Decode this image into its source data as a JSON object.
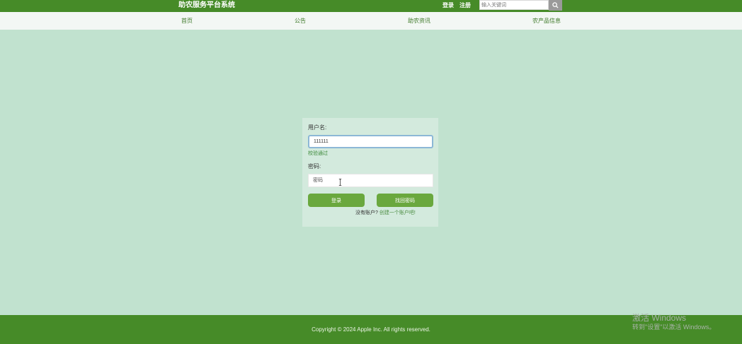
{
  "header": {
    "brand": "助农服务平台系统",
    "login_link": "登录",
    "register_link": "注册",
    "search_placeholder": "输入关键词",
    "search_icon": "search-icon"
  },
  "nav": {
    "items": [
      {
        "label": "首页"
      },
      {
        "label": "公告"
      },
      {
        "label": "助农资讯"
      },
      {
        "label": "农产品信息"
      }
    ]
  },
  "login_form": {
    "username_label": "用户名:",
    "username_value": "111111",
    "username_hint": "校验通过",
    "password_label": "密码:",
    "password_placeholder": "密码",
    "login_button": "登录",
    "forgot_button": "找回密码",
    "no_account_text": "没有账户?",
    "create_account_link": "创建一个账户吧!"
  },
  "footer": {
    "copyright": "Copyright © 2024 Apple Inc. All rights reserved."
  },
  "watermark": {
    "title": "激活 Windows",
    "subtitle": "转到\"设置\"以激活 Windows。"
  },
  "colors": {
    "header_green": "#468b28",
    "page_background": "#c1e2cf",
    "button_green": "#6aa83e",
    "nav_background": "#f3f7f4"
  }
}
